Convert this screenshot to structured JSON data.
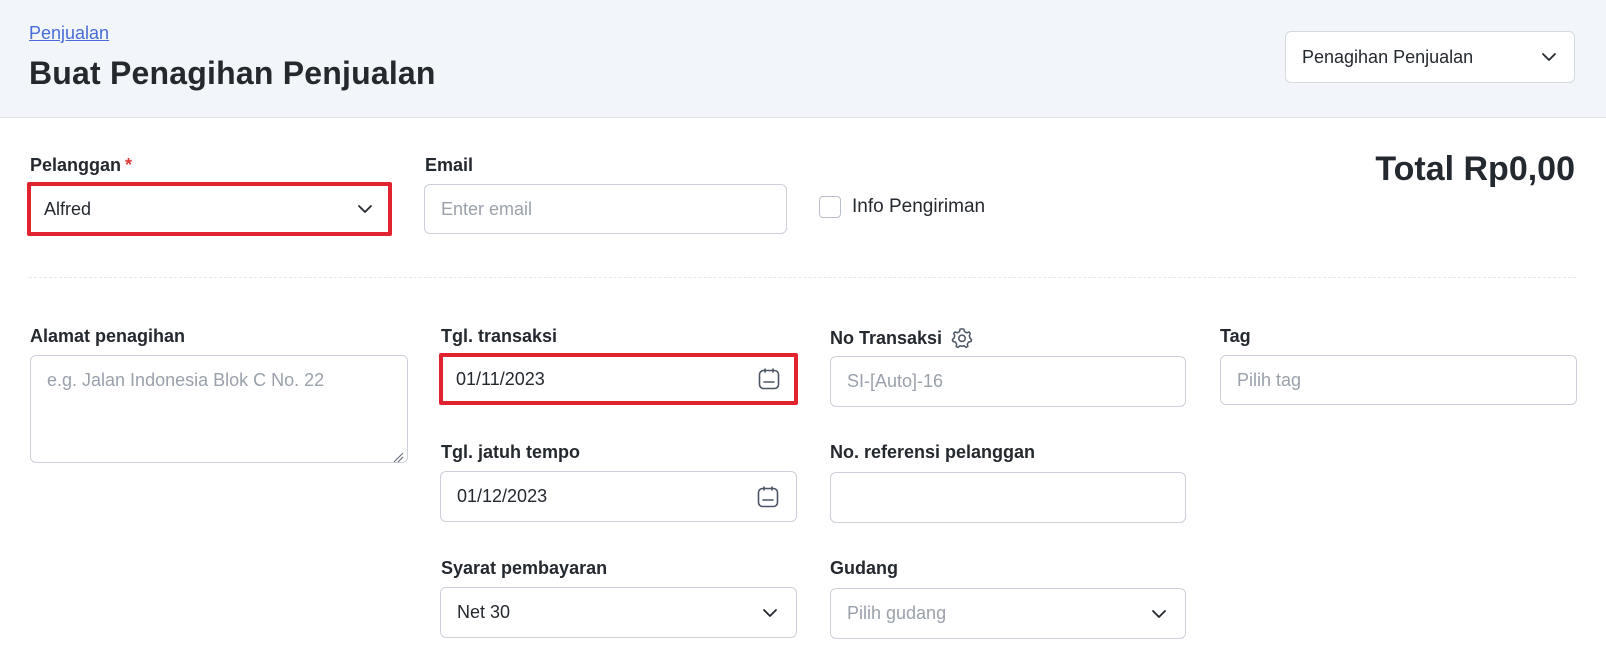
{
  "header": {
    "breadcrumb": "Penjualan",
    "title": "Buat Penagihan Penjualan",
    "type_select": "Penagihan Penjualan"
  },
  "form": {
    "customer": {
      "label": "Pelanggan",
      "required_mark": "*",
      "value": "Alfred"
    },
    "email": {
      "label": "Email",
      "placeholder": "Enter email"
    },
    "shipping": {
      "label": "Info Pengiriman",
      "checked": false
    },
    "total": "Total Rp0,00",
    "billing_address": {
      "label": "Alamat penagihan",
      "placeholder": "e.g. Jalan Indonesia Blok C No. 22"
    },
    "transaction_date": {
      "label": "Tgl. transaksi",
      "value": "01/11/2023"
    },
    "due_date": {
      "label": "Tgl. jatuh tempo",
      "value": "01/12/2023"
    },
    "payment_terms": {
      "label": "Syarat pembayaran",
      "value": "Net 30"
    },
    "transaction_no": {
      "label": "No Transaksi",
      "placeholder": "SI-[Auto]-16"
    },
    "customer_ref": {
      "label": "No. referensi pelanggan",
      "value": ""
    },
    "warehouse": {
      "label": "Gudang",
      "placeholder": "Pilih gudang"
    },
    "tag": {
      "label": "Tag",
      "placeholder": "Pilih tag"
    }
  },
  "colors": {
    "highlight": "#e0232e",
    "link": "#4a6cd8",
    "header_bg": "#f2f5fa"
  }
}
